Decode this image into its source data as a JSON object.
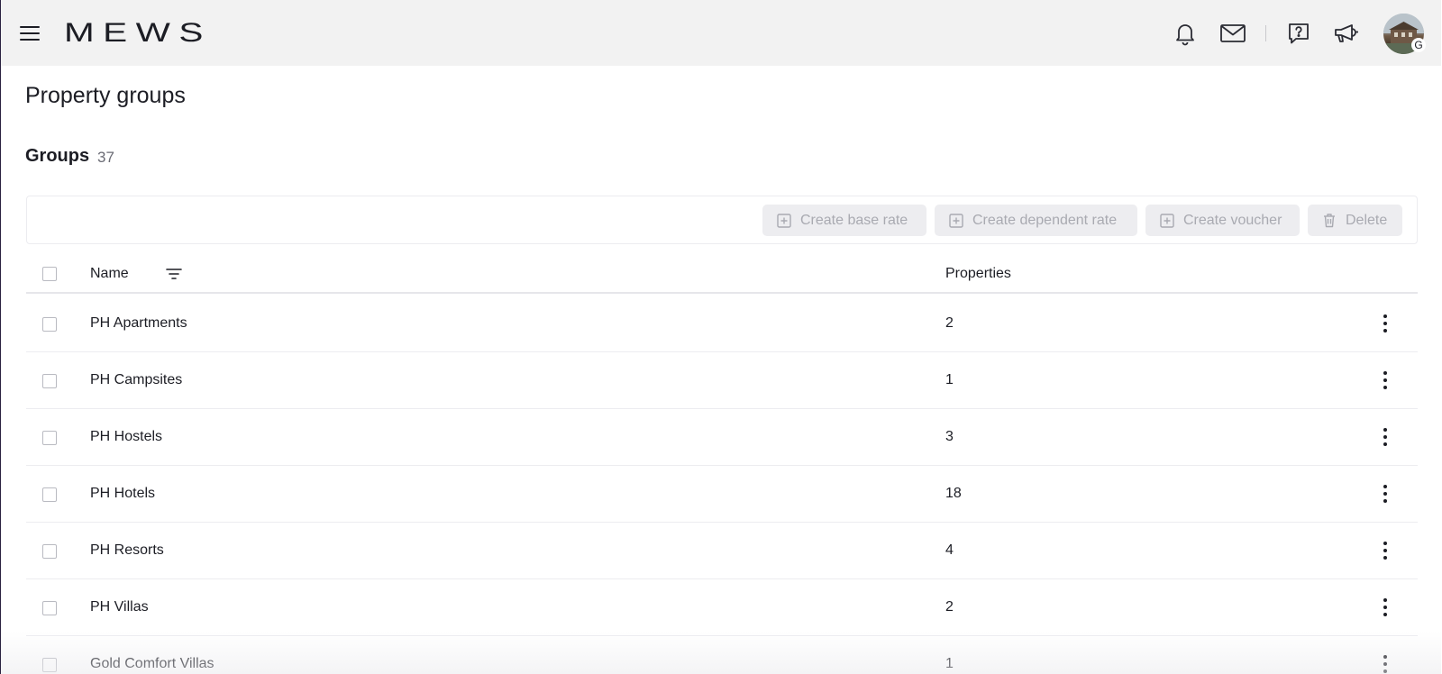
{
  "header": {
    "logo": "MEWS",
    "menu_icon": "hamburger-menu-icon",
    "icons": [
      "bell-icon",
      "mail-icon",
      "help-icon",
      "megaphone-icon"
    ],
    "avatar_badge": "G"
  },
  "page": {
    "title": "Property groups"
  },
  "groups": {
    "title": "Groups",
    "count": "37"
  },
  "toolbar": {
    "create_base_rate": "Create base rate",
    "create_dependent_rate": "Create dependent rate",
    "create_voucher": "Create voucher",
    "delete": "Delete"
  },
  "table": {
    "columns": {
      "name": "Name",
      "properties": "Properties"
    },
    "rows": [
      {
        "name": "PH Apartments",
        "properties": "2"
      },
      {
        "name": "PH Campsites",
        "properties": "1"
      },
      {
        "name": "PH Hostels",
        "properties": "3"
      },
      {
        "name": "PH Hotels",
        "properties": "18"
      },
      {
        "name": "PH Resorts",
        "properties": "4"
      },
      {
        "name": "PH Villas",
        "properties": "2"
      },
      {
        "name": "Gold Comfort Villas",
        "properties": "1"
      }
    ]
  },
  "colors": {
    "topbar_bg": "#f2f2f2",
    "text": "#1c1d24",
    "disabled_button_bg": "#ededf0",
    "disabled_button_text": "#a9aab1"
  }
}
